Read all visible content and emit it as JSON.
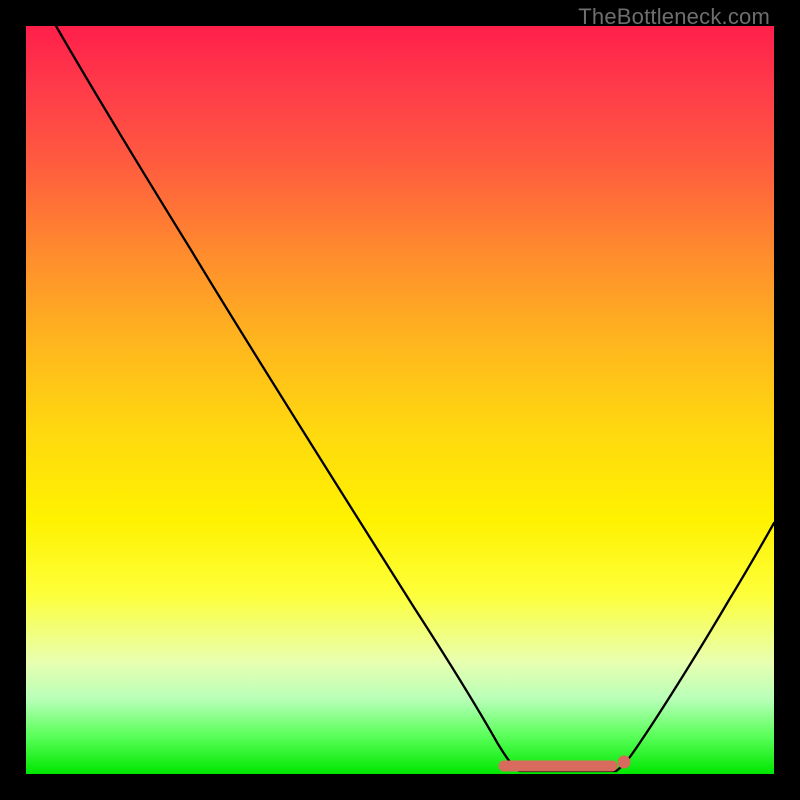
{
  "watermark": "TheBottleneck.com",
  "chart_data": {
    "type": "line",
    "title": "",
    "xlabel": "",
    "ylabel": "",
    "xlim": [
      0,
      100
    ],
    "ylim": [
      0,
      100
    ],
    "grid": false,
    "legend": false,
    "series": [
      {
        "name": "curve",
        "x": [
          4,
          8,
          14,
          22,
          32,
          42,
          52,
          60,
          63,
          66,
          70,
          74,
          78,
          80,
          83,
          88,
          93,
          100
        ],
        "values": [
          100,
          93,
          83,
          70,
          54,
          38,
          22,
          9,
          4,
          1,
          0,
          0,
          0,
          1,
          4,
          12,
          22,
          38
        ]
      }
    ],
    "plateau": {
      "x_start": 62,
      "x_end": 80,
      "y": 0
    },
    "colors": {
      "curve": "#000000",
      "plateau_marker": "#d86a5e",
      "gradient_top": "#ff1f4a",
      "gradient_mid": "#fff200",
      "gradient_bottom": "#00e600"
    }
  }
}
